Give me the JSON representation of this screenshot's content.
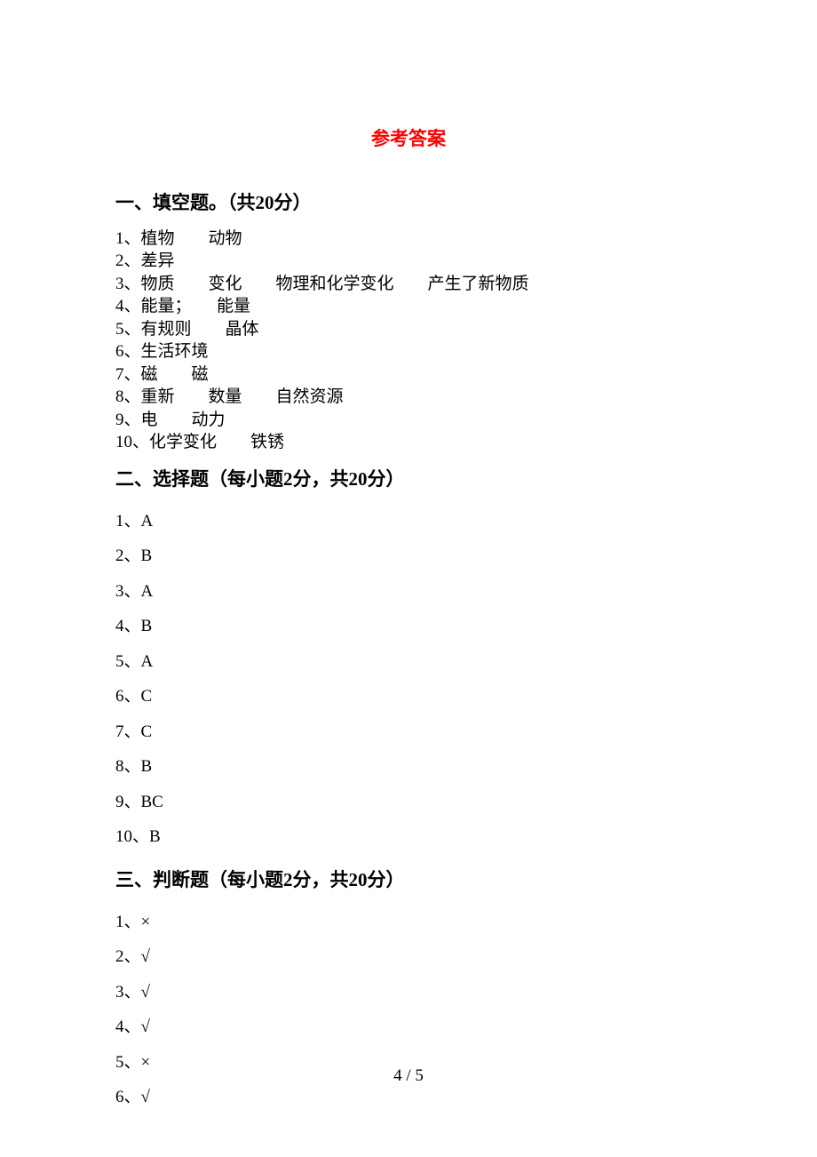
{
  "title": "参考答案",
  "sections": {
    "s1": {
      "header": "一、填空题。（共20分）",
      "items": [
        "1、植物　　动物",
        "2、差异",
        "3、物质　　变化　　物理和化学变化　　产生了新物质",
        "4、能量；　　能量",
        "5、有规则　　晶体",
        "6、生活环境",
        "7、磁　　磁",
        "8、重新　　数量　　自然资源",
        "9、电　　动力",
        "10、化学变化　　铁锈"
      ]
    },
    "s2": {
      "header": "二、选择题（每小题2分，共20分）",
      "items": [
        "1、A",
        "2、B",
        "3、A",
        "4、B",
        "5、A",
        "6、C",
        "7、C",
        "8、B",
        "9、BC",
        "10、B"
      ]
    },
    "s3": {
      "header": "三、判断题（每小题2分，共20分）",
      "items": [
        "1、×",
        "2、√",
        "3、√",
        "4、√",
        "5、×",
        "6、√"
      ]
    }
  },
  "page_number": "4 / 5"
}
